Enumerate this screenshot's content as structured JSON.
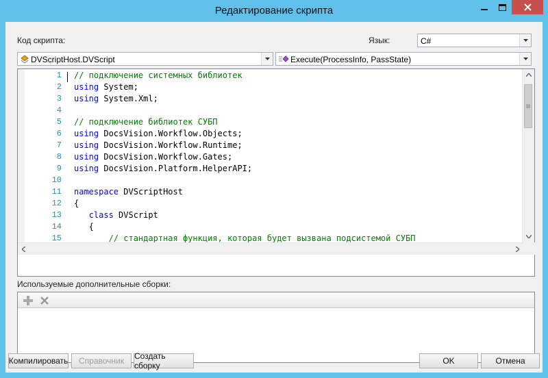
{
  "window": {
    "title": "Редактирование скрипта"
  },
  "labels": {
    "script_code": "Код скрипта:",
    "language": "Язык:",
    "assemblies": "Используемые дополнительные сборки:"
  },
  "language_select": {
    "value": "C#"
  },
  "class_select": {
    "value": "DVScriptHost.DVScript"
  },
  "method_select": {
    "value": "Execute(ProcessInfo, PassState)"
  },
  "code": {
    "line_numbers": [
      "1",
      "2",
      "3",
      "4",
      "5",
      "6",
      "7",
      "8",
      "9",
      "10",
      "11",
      "12",
      "13",
      "14",
      "15"
    ],
    "lines": [
      "// подключение системных библиотек",
      "using System;",
      "using System.Xml;",
      "",
      "// подключение библиотек СУБП",
      "using DocsVision.Workflow.Objects;",
      "using DocsVision.Workflow.Runtime;",
      "using DocsVision.Workflow.Gates;",
      "using DocsVision.Platform.HelperAPI;",
      "",
      "namespace DVScriptHost",
      "{",
      "   class DVScript",
      "   {",
      "       // стандартная функция, которая будет вызвана подсистемой СУБП"
    ]
  },
  "buttons": {
    "compile": "Компилировать",
    "reference": "Справочник",
    "create_assembly": "Создать сборку",
    "ok": "OK",
    "cancel": "Отмена"
  },
  "icons": {
    "minimize": "minimize-icon",
    "maximize": "maximize-icon",
    "close": "close-icon",
    "add": "add-icon",
    "remove": "remove-icon"
  },
  "colors": {
    "keyword": "#0000ff",
    "comment": "#008000",
    "line_number": "#2b91af",
    "title_bar": "#5fc1ea",
    "close_button": "#c7504f"
  }
}
